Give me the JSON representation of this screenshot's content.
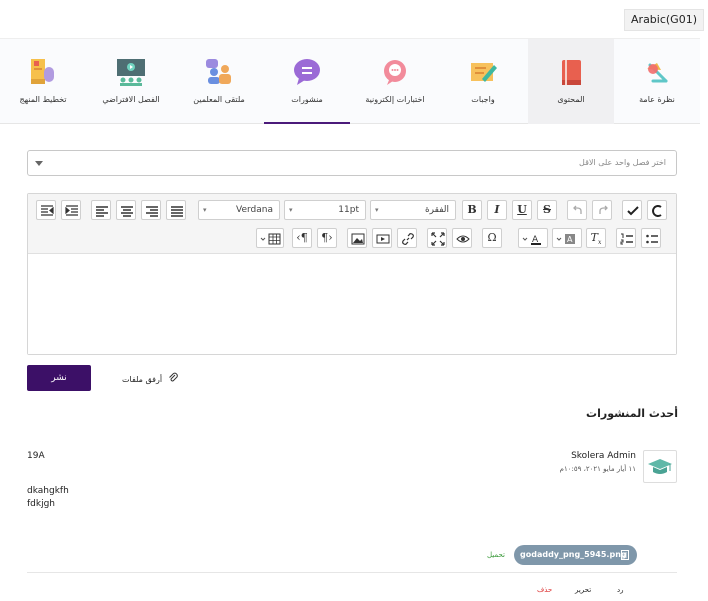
{
  "class_selector": "Arabic(G01)",
  "tabs": [
    {
      "label": "نظرة عامة",
      "icon": "overview-icon"
    },
    {
      "label": "المحتوى",
      "icon": "book-icon"
    },
    {
      "label": "واجبات",
      "icon": "assignment-icon"
    },
    {
      "label": "اختبارات إلكترونية",
      "icon": "quiz-icon"
    },
    {
      "label": "منشورات",
      "icon": "posts-icon"
    },
    {
      "label": "ملتقى المعلمين",
      "icon": "teachers-icon"
    },
    {
      "label": "الفصل الافتراضي",
      "icon": "virtual-class-icon"
    },
    {
      "label": "تخطيط المنهج",
      "icon": "curriculum-icon"
    }
  ],
  "select_class": {
    "placeholder": "اختر فصل واحد على الاقل"
  },
  "editor": {
    "paragraph_format": "الفقرة",
    "font_size": "11pt",
    "font_family": "Verdana"
  },
  "publish_label": "نشر",
  "attach_label": "أرفق ملفات",
  "latest_posts_title": "أحدث المنشورات",
  "post": {
    "author": "Skolera Admin",
    "date": "١١ أيار مايو ٢٠٢١، ١٠:٥٩م",
    "grade": "19A",
    "body_line1": "dkahgkfh",
    "body_line2": "fdkjgh",
    "attachment_name": "godaddy_png_5945.png",
    "download_label": "تحميل",
    "reply_label": "رد",
    "edit_label": "تحرير",
    "delete_label": "حذف"
  },
  "colors": {
    "primary": "#3c1067",
    "tab_indicator": "#4b1a7a",
    "chip": "#7f97aa",
    "delete": "#dd3333",
    "download": "#3a9a3a"
  }
}
